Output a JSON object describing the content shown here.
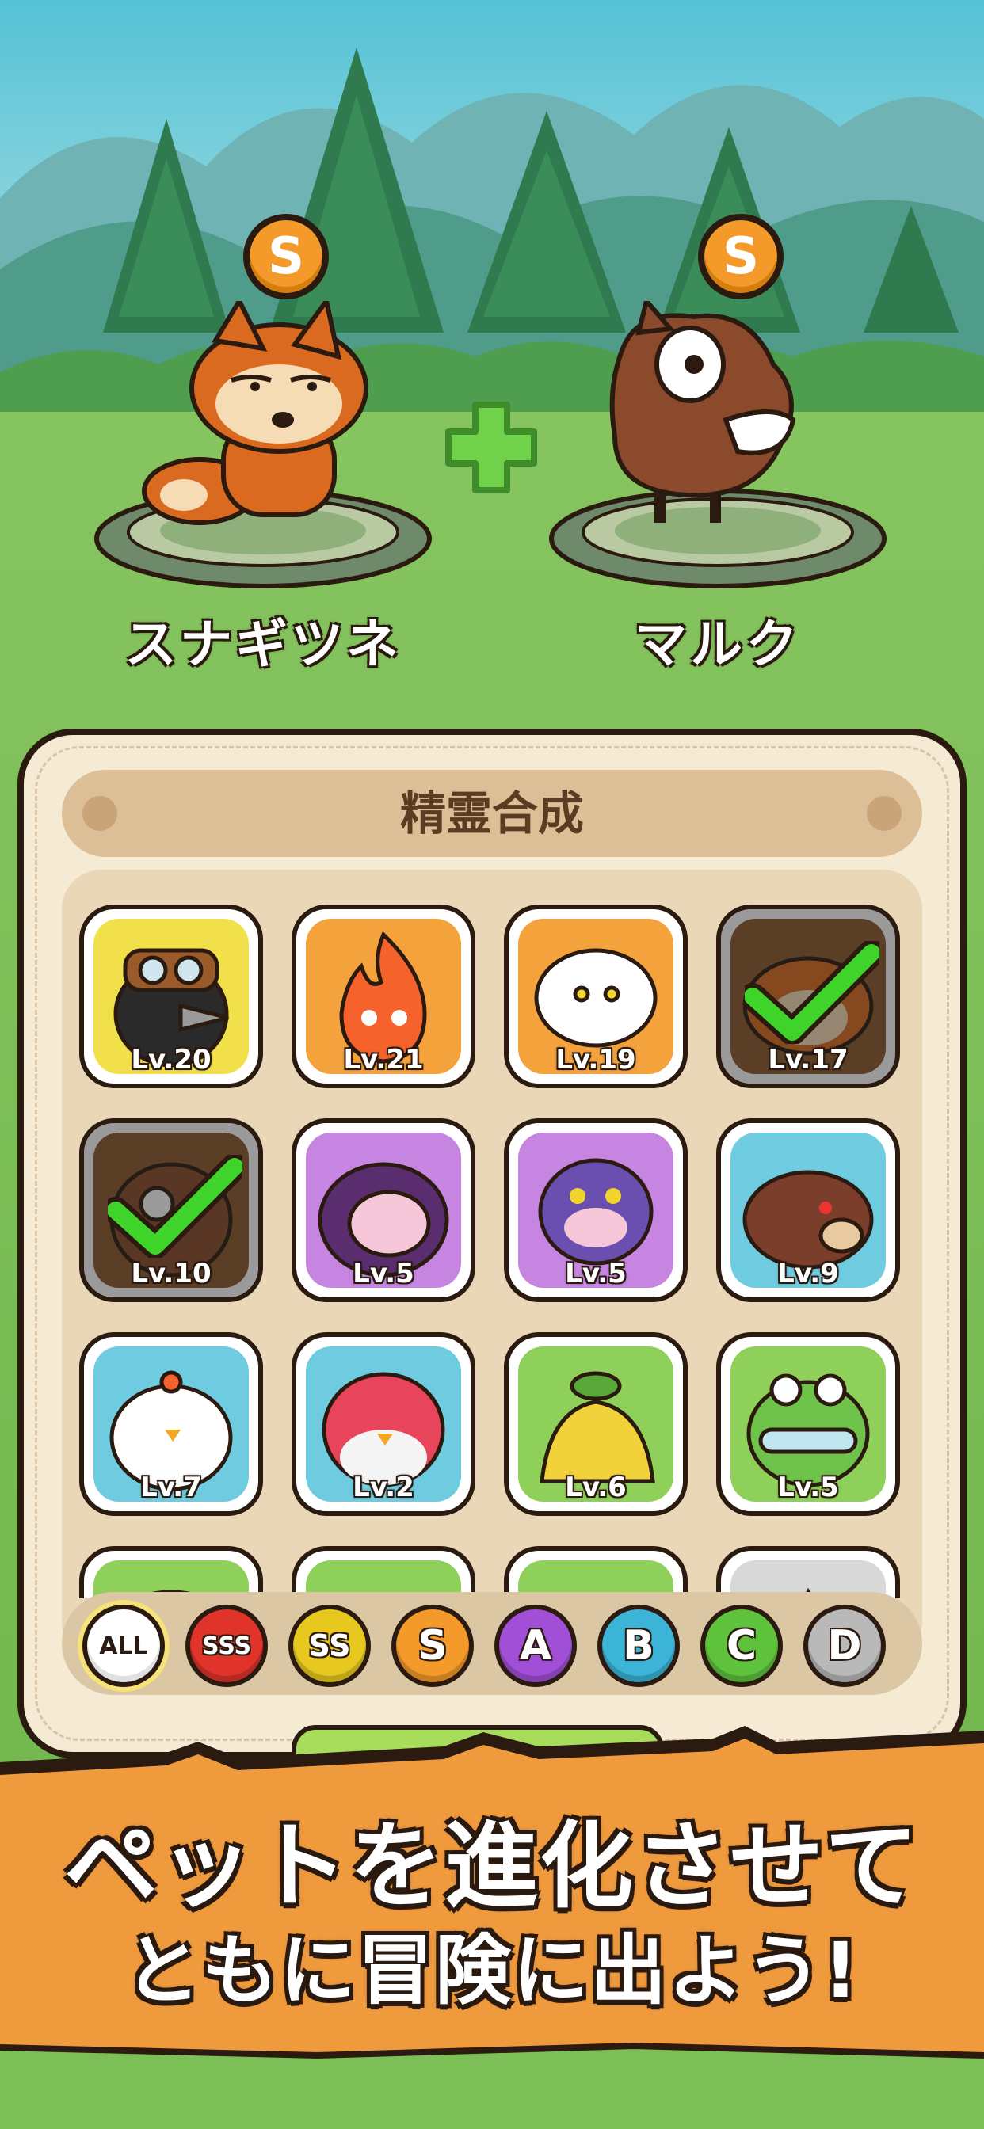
{
  "merge_preview": {
    "left_pet": {
      "rank": "S",
      "name": "スナギツネ"
    },
    "right_pet": {
      "rank": "S",
      "name": "マルク"
    }
  },
  "panel": {
    "title": "精霊合成"
  },
  "pets": [
    {
      "level": "Lv.20",
      "bg": "#f2e04a",
      "creature": "crow-pilot",
      "selected": false
    },
    {
      "level": "Lv.21",
      "bg": "#f4a23c",
      "creature": "fire-spirit",
      "selected": false
    },
    {
      "level": "Lv.19",
      "bg": "#f4a23c",
      "creature": "cloud-spirit",
      "selected": false
    },
    {
      "level": "Lv.17",
      "bg": "#8a5a2c",
      "creature": "sand-fox",
      "selected": true
    },
    {
      "level": "Lv.10",
      "bg": "#8a5a2c",
      "creature": "horse",
      "selected": true
    },
    {
      "level": "Lv.5",
      "bg": "#c585e0",
      "creature": "shadow-blob",
      "selected": false
    },
    {
      "level": "Lv.5",
      "bg": "#c585e0",
      "creature": "purple-octopus",
      "selected": false
    },
    {
      "level": "Lv.9",
      "bg": "#6fcbe0",
      "creature": "boar",
      "selected": false
    },
    {
      "level": "Lv.7",
      "bg": "#6fcbe0",
      "creature": "chick",
      "selected": false
    },
    {
      "level": "Lv.2",
      "bg": "#6fcbe0",
      "creature": "puffer-bird",
      "selected": false
    },
    {
      "level": "Lv.6",
      "bg": "#8ed05a",
      "creature": "sprout-blob",
      "selected": false
    },
    {
      "level": "Lv.5",
      "bg": "#8ed05a",
      "creature": "frog",
      "selected": false
    },
    {
      "level": "",
      "bg": "#8ed05a",
      "creature": "cabbage",
      "selected": false
    },
    {
      "level": "",
      "bg": "#8ed05a",
      "creature": "leaf",
      "selected": false
    },
    {
      "level": "",
      "bg": "#8ed05a",
      "creature": "leaf",
      "selected": false
    },
    {
      "level": "",
      "bg": "#d8d8d8",
      "creature": "grey",
      "selected": false
    }
  ],
  "filters": [
    {
      "label": "ALL",
      "color": "#ffffff",
      "text_color": "#2a1a10",
      "active": true
    },
    {
      "label": "SSS",
      "color": "#e0342b",
      "text_color": "#ffffff",
      "active": false
    },
    {
      "label": "SS",
      "color": "#e7c81f",
      "text_color": "#ffffff",
      "active": false
    },
    {
      "label": "S",
      "color": "#f39a2b",
      "text_color": "#ffffff",
      "active": false
    },
    {
      "label": "A",
      "color": "#a04fd6",
      "text_color": "#ffffff",
      "active": false
    },
    {
      "label": "B",
      "color": "#3bb4d8",
      "text_color": "#ffffff",
      "active": false
    },
    {
      "label": "C",
      "color": "#5fc23c",
      "text_color": "#ffffff",
      "active": false
    },
    {
      "label": "D",
      "color": "#b9b9b9",
      "text_color": "#ffffff",
      "active": false
    }
  ],
  "banner": {
    "line1": "ペットを進化させて",
    "line2": "ともに冒険に出よう!"
  }
}
